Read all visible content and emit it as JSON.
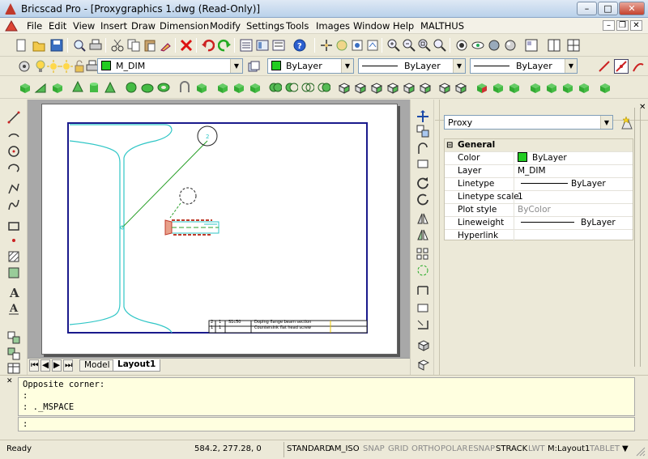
{
  "window": {
    "title": "Bricscad Pro - [Proxygraphics 1.dwg (Read-Only)]",
    "minimize": "–",
    "maximize": "□",
    "close": "✕"
  },
  "menu": [
    "File",
    "Edit",
    "View",
    "Insert",
    "Draw",
    "Dimension",
    "Modify",
    "Settings",
    "Tools",
    "Images",
    "Window",
    "Help",
    "MALTHUS"
  ],
  "mdi": {
    "minimize": "–",
    "restore": "❐",
    "close": "✕"
  },
  "layer_bar": {
    "layer": "M_DIM",
    "color": "ByLayer",
    "linetype": "ByLayer",
    "lineweight": "ByLayer",
    "layer_color": "#22cc22"
  },
  "tabs": {
    "nav": [
      "⏮",
      "◀",
      "▶",
      "⏭"
    ],
    "items": [
      "Model",
      "Layout1"
    ],
    "active": "Layout1"
  },
  "drawing": {
    "title_block": {
      "row1": {
        "num": "2",
        "qty": "1",
        "code": "S1c50",
        "desc": "Doping flange beam section"
      },
      "row2": {
        "num": "1",
        "qty": "1",
        "code": "",
        "desc": "Countersink flat head screw"
      }
    }
  },
  "properties": {
    "selector": "Proxy",
    "section": "General",
    "rows": [
      {
        "name": "Color",
        "value": "ByLayer",
        "kind": "color"
      },
      {
        "name": "Layer",
        "value": "M_DIM",
        "kind": "text"
      },
      {
        "name": "Linetype",
        "value": "ByLayer",
        "kind": "line"
      },
      {
        "name": "Linetype scale",
        "value": "1",
        "kind": "text"
      },
      {
        "name": "Plot style",
        "value": "ByColor",
        "kind": "grey"
      },
      {
        "name": "Lineweight",
        "value": "ByLayer",
        "kind": "line"
      },
      {
        "name": "Hyperlink",
        "value": "",
        "kind": "text"
      }
    ],
    "collapse_symbol": "⊟"
  },
  "command": {
    "history": [
      "Opposite corner:",
      ":",
      ": ._MSPACE"
    ],
    "prompt": ":"
  },
  "status": {
    "ready": "Ready",
    "coords": "584.2, 277.28, 0",
    "toggles": [
      {
        "label": "STANDARD",
        "on": true
      },
      {
        "label": "AM_ISO",
        "on": true
      },
      {
        "label": "SNAP",
        "on": false
      },
      {
        "label": "GRID",
        "on": false
      },
      {
        "label": "ORTHO",
        "on": false
      },
      {
        "label": "POLAR",
        "on": false
      },
      {
        "label": "ESNAP",
        "on": false
      },
      {
        "label": "STRACK",
        "on": true
      },
      {
        "label": "LWT",
        "on": false
      },
      {
        "label": "M:Layout1",
        "on": true
      },
      {
        "label": "TABLET",
        "on": false
      }
    ]
  }
}
